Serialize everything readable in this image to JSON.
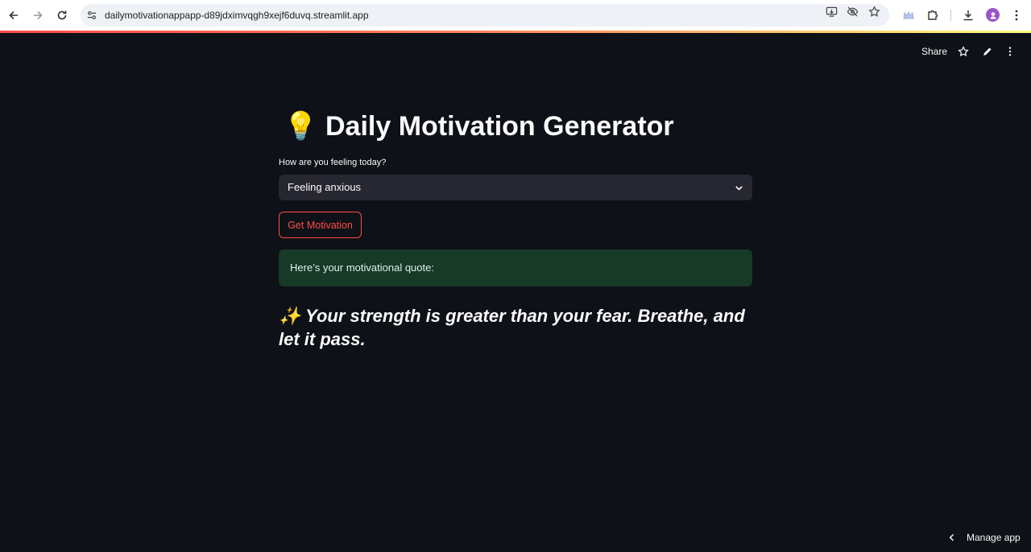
{
  "browser": {
    "url": "dailymotivationappapp-d89jdximvqgh9xejf6duvq.streamlit.app",
    "icons": [
      "back-icon",
      "forward-icon",
      "reload-icon",
      "site-settings-icon",
      "install-app-icon",
      "eye-off-icon",
      "bookmark-star-icon",
      "crown-icon",
      "extensions-icon",
      "download-icon",
      "avatar",
      "menu-icon"
    ]
  },
  "streamlit_header": {
    "share_label": "Share",
    "icons": [
      "star-icon",
      "edit-pencil-icon",
      "more-vert-icon"
    ]
  },
  "app": {
    "title_emoji": "💡",
    "title": "Daily Motivation Generator",
    "select_label": "How are you feeling today?",
    "select_value": "Feeling anxious",
    "button_label": "Get Motivation",
    "success_message": "Here’s your motivational quote:",
    "quote": "✨ Your strength is greater than your fear. Breathe, and let it pass."
  },
  "footer": {
    "manage_label": "Manage app"
  },
  "colors": {
    "background": "#0e1117",
    "accent": "#ff4b4b",
    "select_bg": "#262730",
    "success_bg": "#173928",
    "text": "#fafafa"
  }
}
